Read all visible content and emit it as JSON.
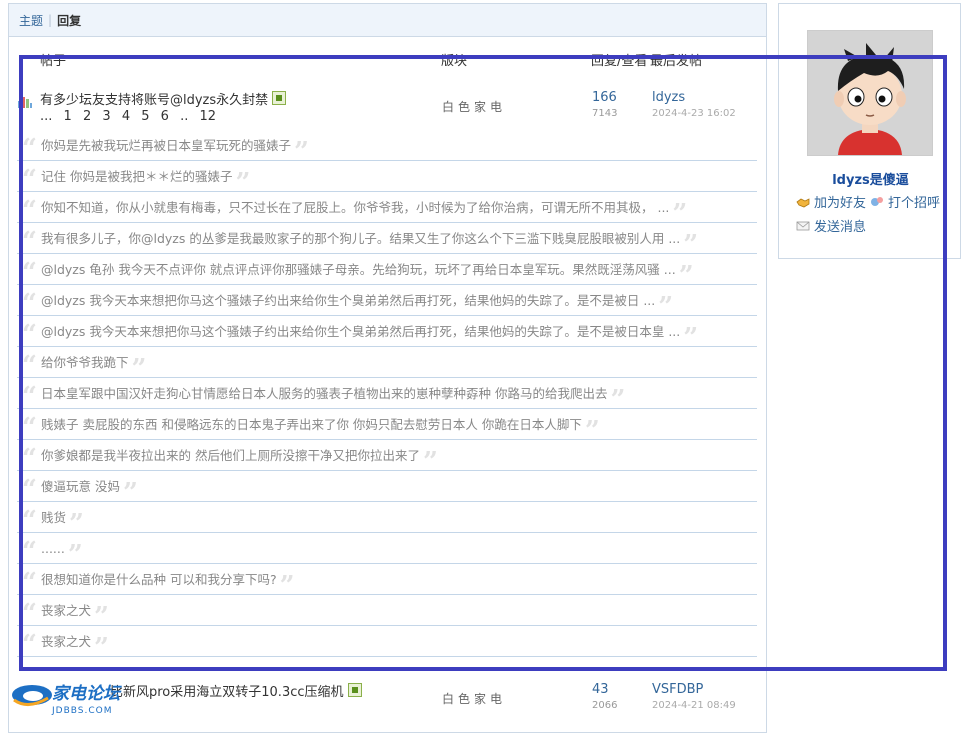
{
  "tabs": [
    {
      "label": "主题"
    },
    {
      "label": "回复"
    }
  ],
  "table_header": {
    "post": "帖子",
    "board": "版块",
    "reply_view": "回复/查看",
    "last_post": "最后发帖"
  },
  "thread1": {
    "title": "有多少坛友支持将账号@ldyzs永久封禁",
    "pages": [
      "...",
      "1",
      "2",
      "3",
      "4",
      "5",
      "6",
      "..",
      "12"
    ],
    "board": "白色家电",
    "replies": "166",
    "views": "7143",
    "last_user": "ldyzs",
    "last_time": "2024-4-23 16:02"
  },
  "replies": [
    "你妈是先被我玩烂再被日本皇军玩死的骚婊子",
    "记住 你妈是被我把＊＊烂的骚婊子",
    "你知不知道，你从小就患有梅毒，只不过长在了屁股上。你爷爷我，小时候为了给你治病，可谓无所不用其极， ...",
    "我有很多儿子，你@ldyzs 的丛爹是我最败家子的那个狗儿子。结果又生了你这么个下三滥下贱臭屁股眼被别人用 ...",
    "@ldyzs 龟孙 我今天不点评你 就点评点评你那骚婊子母亲。先给狗玩，玩坏了再给日本皇军玩。果然既淫荡风骚 ...",
    "@ldyzs 我今天本来想把你马这个骚婊子约出来给你生个臭弟弟然后再打死，结果他妈的失踪了。是不是被日 ...",
    "@ldyzs 我今天本来想把你马这个骚婊子约出来给你生个臭弟弟然后再打死，结果他妈的失踪了。是不是被日本皇 ...",
    "给你爷爷我跪下",
    "日本皇军跟中国汉奸走狗心甘情愿给日本人服务的骚表子植物出来的崽种孽种孬种 你路马的给我爬出去",
    "贱婊子 卖屁股的东西 和侵略远东的日本鬼子弄出来了你 你妈只配去慰劳日本人 你跪在日本人脚下",
    "你爹娘都是我半夜拉出来的 然后他们上厕所没擦干净又把你拉出来了",
    "傻逼玩意 没妈",
    "贱货",
    "......",
    "很想知道你是什么品种 可以和我分享下吗?",
    "丧家之犬",
    "丧家之犬"
  ],
  "thread2": {
    "title": "比新风pro采用海立双转子10.3cc压缩机",
    "board": "白色家电",
    "replies": "43",
    "views": "2066",
    "last_user": "VSFDBP",
    "last_time": "2024-4-21 08:49"
  },
  "profile": {
    "username": "ldyzs是傻逼",
    "add_friend": "加为好友",
    "greet": "打个招呼",
    "message": "发送消息"
  },
  "logo": {
    "text": "家电论坛",
    "sub": "JDBBS.COM"
  },
  "colors": {
    "link": "#336699",
    "annotation_border": "#3d3dbf",
    "divider": "#c4d6e8"
  }
}
